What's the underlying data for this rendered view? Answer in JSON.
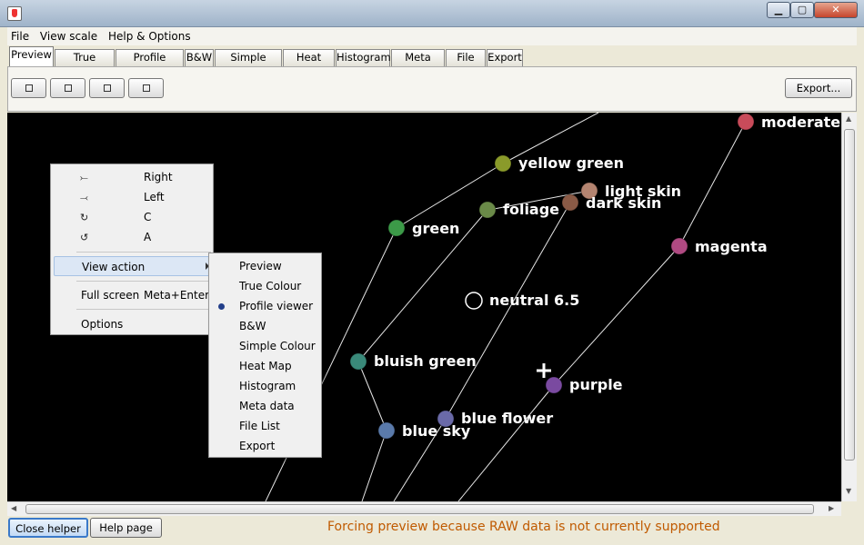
{
  "window": {
    "min_label": "▁",
    "max_label": "▢",
    "close_label": "✕"
  },
  "menubar": [
    "File",
    "View scale",
    "Help & Options"
  ],
  "tabs": [
    "Preview",
    "True Colour",
    "Profile viewer",
    "B&W",
    "Simple Colour",
    "Heat Map",
    "Histogram",
    "Meta data",
    "File List",
    "Export"
  ],
  "active_tab": "Preview",
  "toolbar": {
    "export_label": "Export..."
  },
  "chart_points": [
    {
      "label": "moderate",
      "color": "#c84b5a"
    },
    {
      "label": "yellow green",
      "color": "#8a9a2a"
    },
    {
      "label": "light skin",
      "color": "#b48470"
    },
    {
      "label": "dark skin",
      "color": "#8a5a46"
    },
    {
      "label": "foliage",
      "color": "#6a8a48"
    },
    {
      "label": "green",
      "color": "#3c9a48"
    },
    {
      "label": "magenta",
      "color": "#b04a82"
    },
    {
      "label": "neutral 6.5",
      "color": "#000000"
    },
    {
      "label": "bluish green",
      "color": "#3a8a7a"
    },
    {
      "label": "purple",
      "color": "#7a4aa0"
    },
    {
      "label": "blue flower",
      "color": "#6a6aa8"
    },
    {
      "label": "blue sky",
      "color": "#5a7aaa"
    }
  ],
  "context_menu": {
    "rotate_items": [
      {
        "icon": "rotate-right-icon",
        "glyph": "⤚",
        "label": "Right"
      },
      {
        "icon": "rotate-left-icon",
        "glyph": "⤙",
        "label": "Left"
      },
      {
        "icon": "rotate-c-icon",
        "glyph": "↻",
        "label": "C"
      },
      {
        "icon": "rotate-a-icon",
        "glyph": "↺",
        "label": "A"
      }
    ],
    "view_action": "View action",
    "full_screen": "Full screen",
    "full_screen_shortcut": "Meta+Enter",
    "options": "Options"
  },
  "submenu": {
    "items": [
      "Preview",
      "True Colour",
      "Profile viewer",
      "B&W",
      "Simple Colour",
      "Heat Map",
      "Histogram",
      "Meta data",
      "File List",
      "Export"
    ],
    "selected": "Profile viewer"
  },
  "bottom": {
    "close_helper": "Close helper",
    "help_page": "Help page",
    "status": "Forcing preview because RAW data is not currently supported"
  }
}
